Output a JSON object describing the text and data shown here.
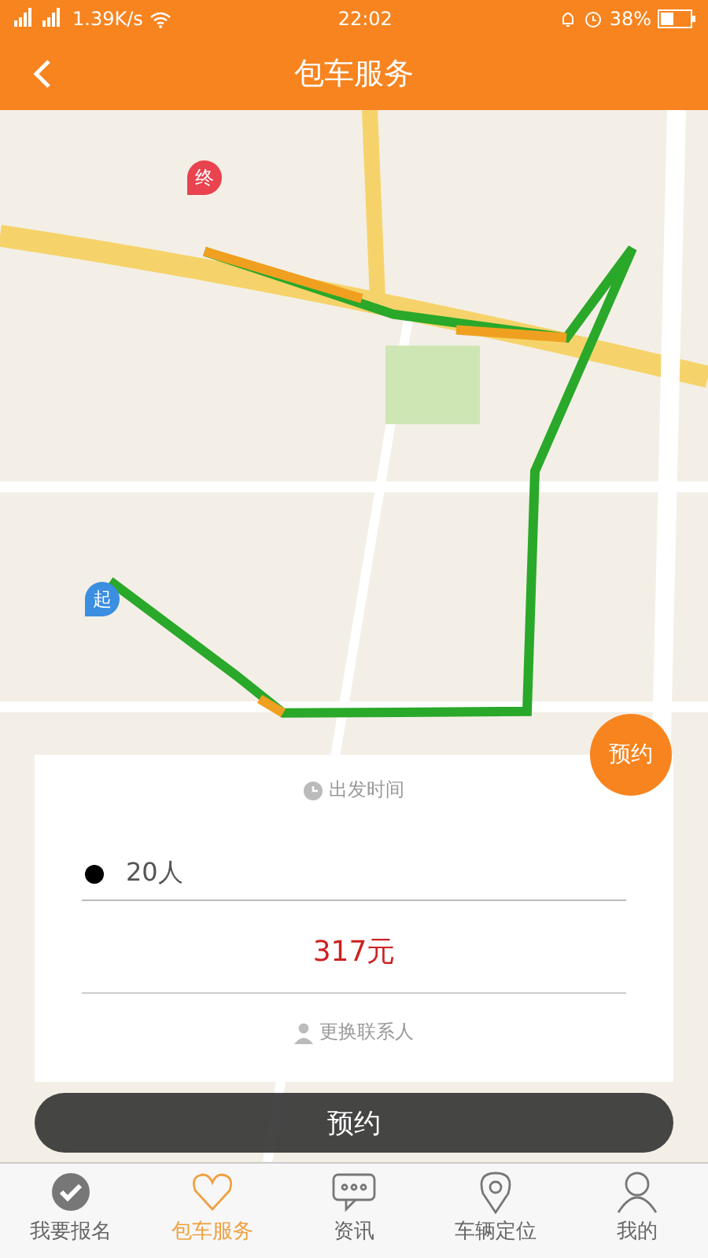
{
  "status_bar": {
    "network": "1.39K/s",
    "time": "22:02",
    "battery": "38%"
  },
  "header": {
    "title": "包车服务"
  },
  "map": {
    "start_marker": "起",
    "end_marker": "终",
    "reserve_badge": "预约"
  },
  "card": {
    "departure_label": "出发时间",
    "passengers": "20人",
    "price": "317元",
    "contact_link": "更换联系人"
  },
  "reserve_button": "预约",
  "tabs": [
    {
      "label": "我要报名",
      "kind": "check",
      "selected": false
    },
    {
      "label": "包车服务",
      "kind": "heart",
      "selected": true
    },
    {
      "label": "资讯",
      "kind": "chat",
      "selected": false
    },
    {
      "label": "车辆定位",
      "kind": "pin",
      "selected": false
    },
    {
      "label": "我的",
      "kind": "person",
      "selected": false
    }
  ]
}
